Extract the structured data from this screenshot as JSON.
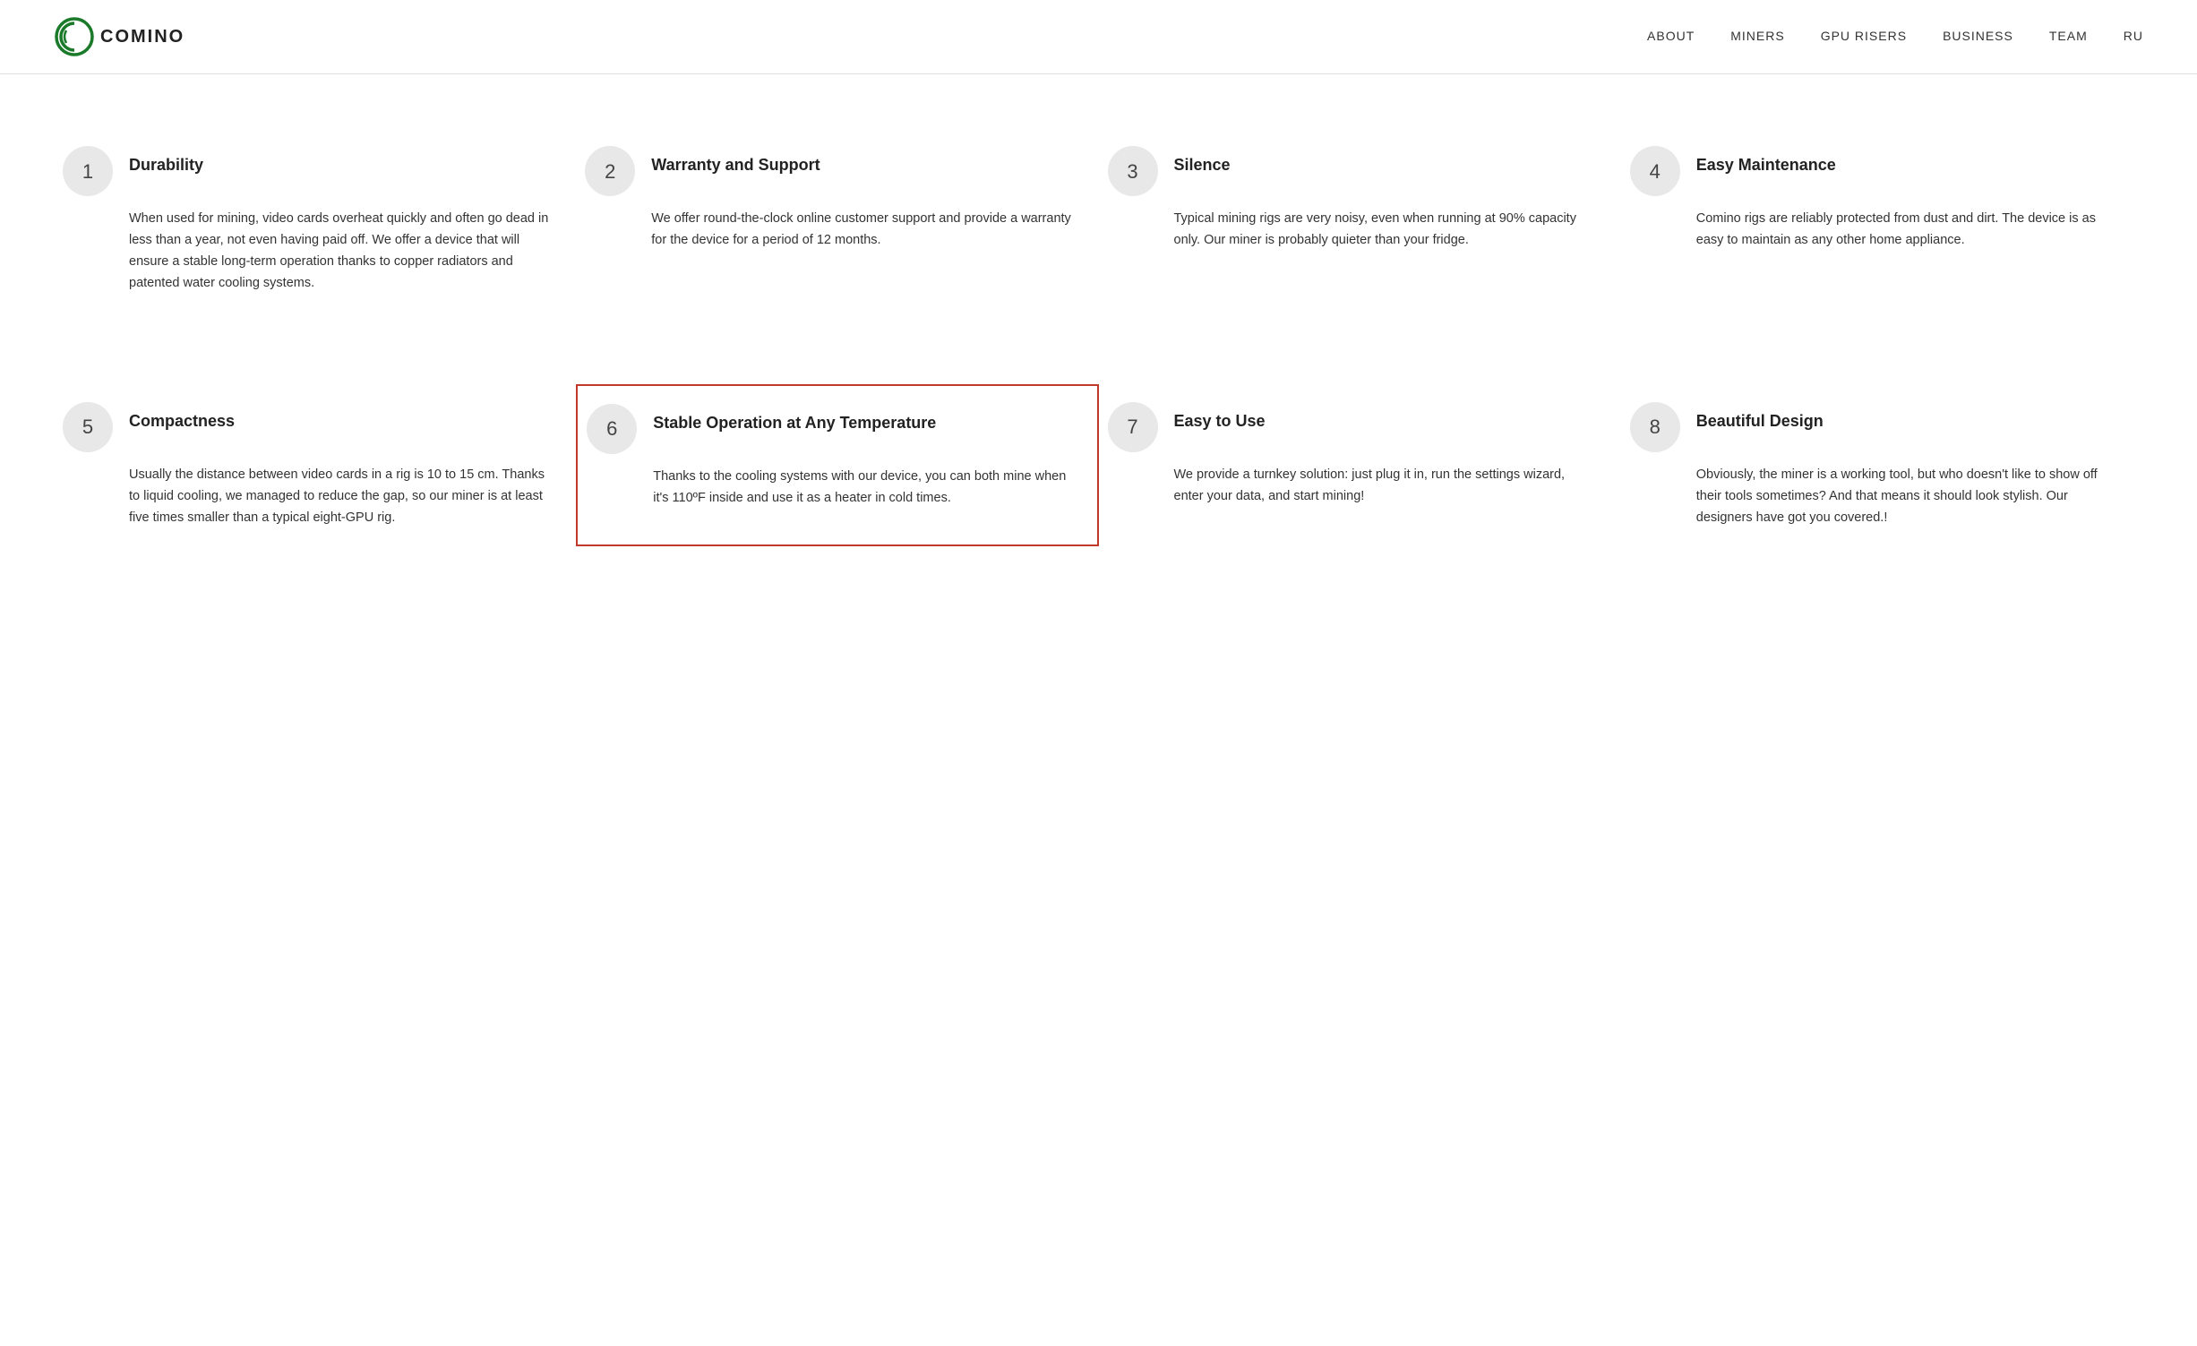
{
  "nav": {
    "logo_text": "COMINO",
    "links": [
      "ABOUT",
      "MINERS",
      "GPU RISERS",
      "BUSINESS",
      "TEAM",
      "RU"
    ]
  },
  "features": [
    {
      "id": 1,
      "number": "1",
      "title": "Durability",
      "body": "When used for mining, video cards overheat quickly and often go dead in less than a year, not even having paid off. We offer a device that will ensure a stable long-term operation thanks to copper radiators and patented water cooling systems.",
      "highlighted": false
    },
    {
      "id": 2,
      "number": "2",
      "title": "Warranty and Support",
      "body": "We offer round-the-clock online customer support and provide a warranty for the device for a period of 12 months.",
      "highlighted": false
    },
    {
      "id": 3,
      "number": "3",
      "title": "Silence",
      "body": "Typical mining rigs are very noisy, even when running at 90% capacity only. Our miner is probably quieter than your fridge.",
      "highlighted": false
    },
    {
      "id": 4,
      "number": "4",
      "title": "Easy Maintenance",
      "body": "Comino rigs are reliably protected from dust and dirt. The device is as easy to maintain as any other home appliance.",
      "highlighted": false
    },
    {
      "id": 5,
      "number": "5",
      "title": "Compactness",
      "body": "Usually the distance between video cards in a rig is 10 to 15 cm. Thanks to liquid cooling, we managed to reduce the gap, so our miner is at least five times smaller than a typical eight-GPU rig.",
      "highlighted": false
    },
    {
      "id": 6,
      "number": "6",
      "title": "Stable Operation at Any Temperature",
      "body": "Thanks to the cooling systems with our device, you can both mine when it's 110ºF inside and use it as a heater in cold times.",
      "highlighted": true
    },
    {
      "id": 7,
      "number": "7",
      "title": "Easy to Use",
      "body": "We provide a turnkey solution: just plug it in, run the settings wizard, enter your data, and start mining!",
      "highlighted": false
    },
    {
      "id": 8,
      "number": "8",
      "title": "Beautiful Design",
      "body": "Obviously, the miner is a working tool, but who doesn't like to show off their tools sometimes? And that means it should look stylish. Our designers have got you covered.!",
      "highlighted": false
    }
  ]
}
